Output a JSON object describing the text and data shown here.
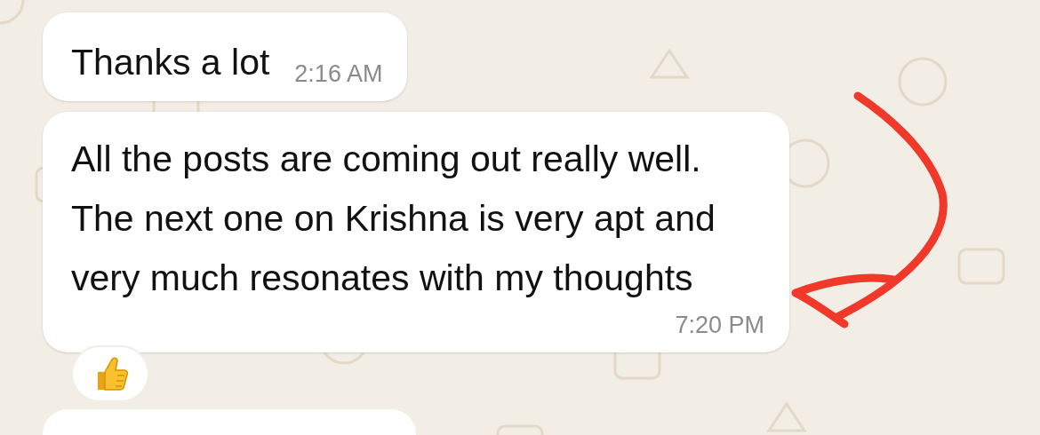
{
  "messages": [
    {
      "text": "Thanks a lot",
      "time": "2:16 AM",
      "kind": "short"
    },
    {
      "text": "All the posts are coming out really well. The next one on Krishna is very apt and very much resonates with my thoughts",
      "time": "7:20 PM",
      "kind": "long",
      "reaction": {
        "kind": "thumbs-up"
      }
    }
  ]
}
